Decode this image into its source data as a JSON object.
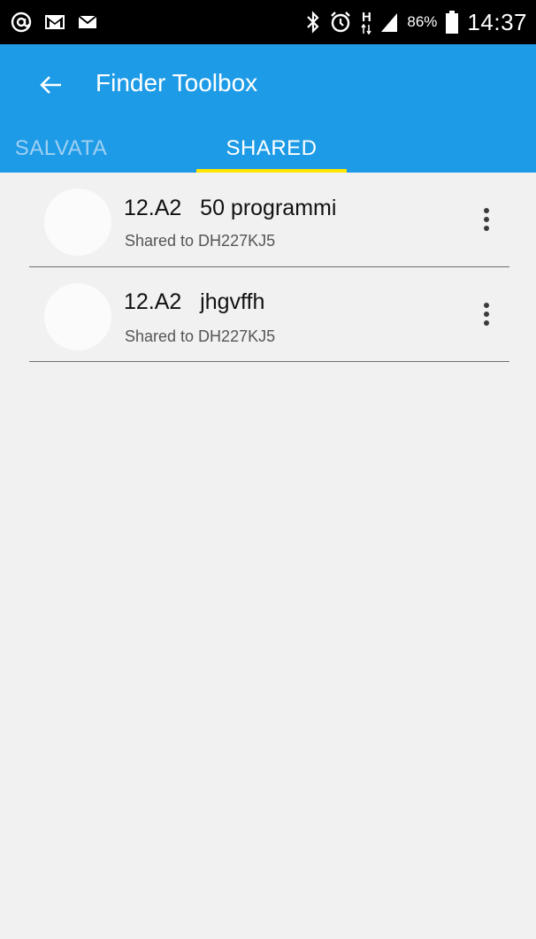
{
  "status_bar": {
    "left_icons": [
      "at-sign-icon",
      "gmail-icon",
      "mail-icon"
    ],
    "right_icons": [
      "bluetooth-icon",
      "alarm-icon",
      "hspa-icon",
      "signal-icon",
      "battery-icon"
    ],
    "network_label": "H",
    "battery": "86%",
    "time": "14:37"
  },
  "app_bar": {
    "back_icon": "arrow-left-icon",
    "title": "Finder Toolbox",
    "color": "#1e9be6"
  },
  "tabs": [
    {
      "label": "SALVATA",
      "active": false
    },
    {
      "label": "SHARED",
      "active": true
    }
  ],
  "tab_indicator_color": "#ffe500",
  "items": [
    {
      "title": "12.A2   50 programmi",
      "subtitle": "Shared to DH227KJ5",
      "menu_icon": "more-vert-icon"
    },
    {
      "title": "12.A2   jhgvffh",
      "subtitle": "Shared to DH227KJ5",
      "menu_icon": "more-vert-icon"
    }
  ]
}
